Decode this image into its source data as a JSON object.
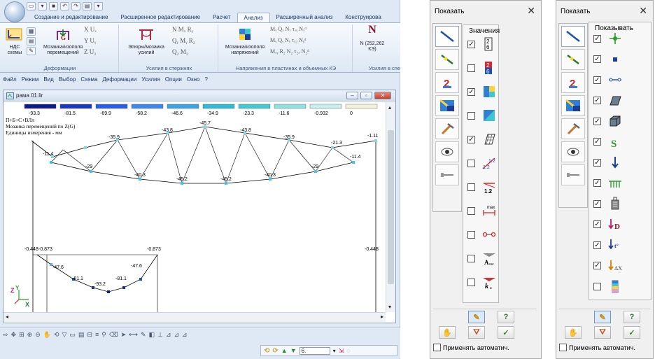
{
  "app": {
    "quick_access": [
      "new-doc",
      "open",
      "save",
      "undo",
      "redo",
      "print",
      "options"
    ],
    "tabs": [
      "Создание и редактирование",
      "Расширенное редактирование",
      "Расчет",
      "Анализ",
      "Расширенный анализ",
      "Конструирова"
    ],
    "active_tab": "Анализ",
    "ribbon": {
      "g1": {
        "label": "Деформации",
        "btn1": "НДС",
        "btn1b": "схемы",
        "btn2": "Мозаика/изополя",
        "btn2b": "перемещений",
        "syms": [
          "X Uₓ",
          "Y Uᵧ",
          "Z U₂"
        ]
      },
      "g2": {
        "label": "Усилия в стержнях",
        "btn": "Эпюры/мозаика",
        "btnb": "усилий",
        "syms": [
          "N Mₓ Rᵧ",
          "Qᵧ Mᵧ R₂",
          "Q₂ M₂"
        ]
      },
      "g3": {
        "label": "Напряжения в пластинах и объемных КЭ",
        "btn": "Мозаика/изополя",
        "btnb": "напряжений",
        "syms": [
          "Mₓ Qₓ Nₓ τₓᵧ Nₓᵈ",
          "Mᵧ Qᵧ Nᵧ τᵧ₂ Nᵧᵈ",
          "Mₓᵧ R₂ N₂ τ₂ₓ N₂ᵈ"
        ]
      },
      "g4": {
        "label": "Усилия в спе",
        "btn": "N (252,262",
        "btnb": "КЭ)"
      }
    },
    "menu": [
      "Файл",
      "Режим",
      "Вид",
      "Выбор",
      "Схема",
      "Деформации",
      "Усилия",
      "Опции",
      "Окно",
      "?"
    ],
    "document": {
      "title": "рама 01.lir",
      "scale_values": [
        "-93.3",
        "-81.5",
        "-69.9",
        "-58.2",
        "-46.6",
        "-34.9",
        "-23.3",
        "-11.6",
        "-0.932",
        "0"
      ],
      "scale_colors": [
        "#0b1a8c",
        "#1637c8",
        "#2a5bf0",
        "#3d86f2",
        "#38a4e8",
        "#2bbcd6",
        "#41cbd0",
        "#8fe0e0",
        "#c6efef",
        "#f3f3dc"
      ],
      "info": [
        "П+Б+С+ВЛл",
        "Мозаика перемещений по Z(G)",
        "Единицы измерения - мм"
      ],
      "truss_labels": [
        "-11.4",
        "-29",
        "-40.3",
        "-45.2",
        "-45.2",
        "-40.3",
        "-29",
        "-11.4",
        "-35.9",
        "-43.8",
        "-45.7",
        "-43.8",
        "-35.9",
        "-21.3",
        "-1.11"
      ],
      "frame_labels": [
        "-0.448",
        "-0.873",
        "-0.873",
        "-0.448",
        "-47.6",
        "-47.6",
        "-81.1",
        "-81.1",
        "-93.2"
      ],
      "axes": {
        "z": "Z",
        "y": "Y",
        "x": "X"
      }
    },
    "status": {
      "zoom_value": "6."
    }
  },
  "panel_values": {
    "title": "Показать",
    "group_label": "Значения",
    "rows": [
      {
        "checked": true,
        "icon": "values-digits-icon"
      },
      {
        "checked": false,
        "icon": "values-colored-digits-icon"
      },
      {
        "checked": true,
        "icon": "color-blocks-icon"
      },
      {
        "checked": false,
        "icon": "color-fill-icon"
      },
      {
        "checked": true,
        "icon": "hatch-plate-icon"
      },
      {
        "checked": false,
        "icon": "ratio-1-2-icon"
      },
      {
        "checked": false,
        "icon": "dimension-1-2-icon"
      },
      {
        "checked": false,
        "icon": "max-marker-icon"
      },
      {
        "checked": false,
        "icon": "rigid-link-icon"
      },
      {
        "checked": false,
        "icon": "asw-reinforcement-icon"
      },
      {
        "checked": false,
        "icon": "ka-coefficient-icon"
      }
    ],
    "auto_label": "Применять автоматич."
  },
  "panel_show": {
    "title": "Показать",
    "group_label": "Показывать",
    "rows": [
      {
        "checked": true,
        "icon": "node-marker-icon"
      },
      {
        "checked": true,
        "icon": "square-node-icon"
      },
      {
        "checked": true,
        "icon": "element-link-icon"
      },
      {
        "checked": true,
        "icon": "plate-shape-icon"
      },
      {
        "checked": true,
        "icon": "solid-shape-icon"
      },
      {
        "checked": true,
        "icon": "stiffness-s-icon"
      },
      {
        "checked": true,
        "icon": "load-arrow-icon"
      },
      {
        "checked": true,
        "icon": "support-icon"
      },
      {
        "checked": true,
        "icon": "weight-icon"
      },
      {
        "checked": true,
        "icon": "load-d-icon"
      },
      {
        "checked": true,
        "icon": "temperature-load-icon"
      },
      {
        "checked": true,
        "icon": "displacement-load-icon"
      },
      {
        "checked": false,
        "icon": "color-column-icon"
      }
    ],
    "letters": {
      "s": "S",
      "d": "D",
      "t": "t°",
      "ax": "ΔX"
    },
    "auto_label": "Применять автоматич."
  }
}
